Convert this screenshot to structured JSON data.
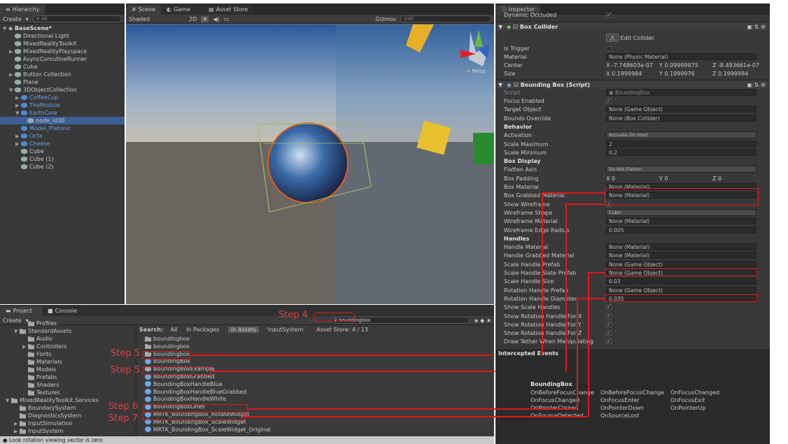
{
  "hierarchy": {
    "tab": "Hierarchy",
    "create": "Create",
    "search_placeholder": "All",
    "scene": "BaseScene*",
    "items": [
      {
        "label": "Directional Light",
        "depth": 1,
        "arrow": "",
        "blue": false
      },
      {
        "label": "MixedRealityToolkit",
        "depth": 1,
        "arrow": "",
        "blue": false
      },
      {
        "label": "MixedRealityPlayspace",
        "depth": 1,
        "arrow": "▶",
        "blue": false
      },
      {
        "label": "AsyncCoroutineRunner",
        "depth": 1,
        "arrow": "",
        "blue": false
      },
      {
        "label": "Cube",
        "depth": 1,
        "arrow": "",
        "blue": false
      },
      {
        "label": "Button Collection",
        "depth": 1,
        "arrow": "▶",
        "blue": false
      },
      {
        "label": "Plane",
        "depth": 1,
        "arrow": "",
        "blue": false
      },
      {
        "label": "3DObjectCollection",
        "depth": 1,
        "arrow": "▼",
        "blue": false
      },
      {
        "label": "CoffeeCup",
        "depth": 2,
        "arrow": "▶",
        "blue": true
      },
      {
        "label": "TheModule",
        "depth": 2,
        "arrow": "▶",
        "blue": true
      },
      {
        "label": "EarthCore",
        "depth": 2,
        "arrow": "▼",
        "blue": true
      },
      {
        "label": "node_id30",
        "depth": 3,
        "arrow": "",
        "blue": false,
        "selected": true
      },
      {
        "label": "Model_Platonic",
        "depth": 2,
        "arrow": "",
        "blue": true
      },
      {
        "label": "Octa",
        "depth": 2,
        "arrow": "▶",
        "blue": true
      },
      {
        "label": "Cheese",
        "depth": 2,
        "arrow": "▶",
        "blue": true
      },
      {
        "label": "Cube",
        "depth": 2,
        "arrow": "",
        "blue": false
      },
      {
        "label": "Cube (1)",
        "depth": 2,
        "arrow": "",
        "blue": false
      },
      {
        "label": "Cube (2)",
        "depth": 2,
        "arrow": "",
        "blue": false
      }
    ]
  },
  "scene": {
    "tabs": [
      "Scene",
      "Game",
      "Asset Store"
    ],
    "shaded": "Shaded",
    "mode_2d": "2D",
    "gizmos": "Gizmos",
    "search_placeholder": "All",
    "persp": "< Persp",
    "axis_y": "y",
    "axis_x": "x",
    "axis_z": "z"
  },
  "project": {
    "tabs": [
      "Project",
      "Console"
    ],
    "create": "Create",
    "search_value": "boundingbox",
    "search_label": "Search:",
    "filters": [
      "All",
      "In Packages",
      "In Assets",
      "'InputSystem'",
      "Asset Store: 4 / 13"
    ],
    "tree": [
      {
        "label": "Profiles",
        "depth": 2,
        "arrow": ""
      },
      {
        "label": "StandardAssets",
        "depth": 1,
        "arrow": "▼"
      },
      {
        "label": "Audio",
        "depth": 2,
        "arrow": ""
      },
      {
        "label": "Controllers",
        "depth": 2,
        "arrow": "▶"
      },
      {
        "label": "Fonts",
        "depth": 2,
        "arrow": ""
      },
      {
        "label": "Materials",
        "depth": 2,
        "arrow": ""
      },
      {
        "label": "Models",
        "depth": 2,
        "arrow": ""
      },
      {
        "label": "Prefabs",
        "depth": 2,
        "arrow": ""
      },
      {
        "label": "Shaders",
        "depth": 2,
        "arrow": ""
      },
      {
        "label": "Textures",
        "depth": 2,
        "arrow": ""
      },
      {
        "label": "MixedRealityToolkit.Services",
        "depth": 0,
        "arrow": "▼"
      },
      {
        "label": "BoundarySystem",
        "depth": 1,
        "arrow": ""
      },
      {
        "label": "DiagnosticsSystem",
        "depth": 1,
        "arrow": ""
      },
      {
        "label": "InputSimulation",
        "depth": 1,
        "arrow": "▶"
      },
      {
        "label": "InputSystem",
        "depth": 1,
        "arrow": "▶"
      }
    ],
    "results": [
      {
        "label": "boundingbox",
        "kind": "file"
      },
      {
        "label": "boundingbox",
        "kind": "file"
      },
      {
        "label": "boundingbox",
        "kind": "file"
      },
      {
        "label": "BoundingBox",
        "kind": "prefab"
      },
      {
        "label": "BoundingBoxExample",
        "kind": "scene"
      },
      {
        "label": "BoundingBoxGrabbed",
        "kind": "prefab"
      },
      {
        "label": "BoundingBoxHandleBlue",
        "kind": "prefab"
      },
      {
        "label": "BoundingBoxHandleBlueGrabbed",
        "kind": "prefab"
      },
      {
        "label": "BoundingBoxHandleWhite",
        "kind": "prefab"
      },
      {
        "label": "BoundingBoxLines",
        "kind": "prefab"
      },
      {
        "label": "MRTK_BoundingBox_RotateWidget",
        "kind": "prefab"
      },
      {
        "label": "MRTK_BoundingBox_ScaleWidget",
        "kind": "prefab"
      },
      {
        "label": "MRTK_BoundingBox_ScaleWidget_Original",
        "kind": "prefab"
      }
    ]
  },
  "status": {
    "text": "Look rotation viewing vector is zero"
  },
  "steps": {
    "s4": "Step 4",
    "s5a": "Step 5",
    "s5b": "Step 5",
    "s6": "Step 6",
    "s7": "Step 7"
  },
  "inspector": {
    "tab": "Inspector",
    "dynamic_occluded": "Dynamic Occluded",
    "box_collider": {
      "title": "Box Collider",
      "edit": "Edit Collider",
      "is_trigger": "Is Trigger",
      "material": "Material",
      "material_val": "None (Physic Material)",
      "center": "Center",
      "center_x": "X -7.748603e-07",
      "center_y": "Y 0.09999875",
      "center_z": "Z -8.493661e-07",
      "size": "Size",
      "size_x": "X 0.1999984",
      "size_y": "Y 0.1999976",
      "size_z": "Z 0.1999984"
    },
    "bbox": {
      "title": "Bounding Box (Script)",
      "script": "Script",
      "script_val": "BoundingBox",
      "rows": [
        {
          "label": "Focus Enabled",
          "type": "check",
          "value": "✓"
        },
        {
          "label": "Target Object",
          "type": "field",
          "value": "None (Game Object)"
        },
        {
          "label": "Bounds Override",
          "type": "field",
          "value": "None (Box Collider)"
        },
        {
          "label": "Behavior",
          "type": "header",
          "value": ""
        },
        {
          "label": "Activation",
          "type": "drop",
          "value": "Activate On Start"
        },
        {
          "label": "Scale Maximum",
          "type": "field",
          "value": "2"
        },
        {
          "label": "Scale Minimum",
          "type": "field",
          "value": "0.2"
        },
        {
          "label": "Box Display",
          "type": "header",
          "value": ""
        },
        {
          "label": "Flatten Axis",
          "type": "drop",
          "value": "Do Not Flatten"
        },
        {
          "label": "Box Padding",
          "type": "xyz",
          "value": "X 0|Y 0|Z 0"
        },
        {
          "label": "Box Material",
          "type": "field",
          "value": "None (Material)"
        },
        {
          "label": "Box Grabbed Material",
          "type": "field",
          "value": "None (Material)"
        },
        {
          "label": "Show Wireframe",
          "type": "check",
          "value": "✓"
        },
        {
          "label": "Wireframe Shape",
          "type": "drop",
          "value": "Cubic"
        },
        {
          "label": "Wireframe Material",
          "type": "field",
          "value": "None (Material)"
        },
        {
          "label": "Wireframe Edge Radius",
          "type": "field",
          "value": "0.005"
        },
        {
          "label": "Handles",
          "type": "header",
          "value": ""
        },
        {
          "label": "Handle Material",
          "type": "field",
          "value": "None (Material)"
        },
        {
          "label": "Handle Grabbed Material",
          "type": "field",
          "value": "None (Material)"
        },
        {
          "label": "Scale Handle Prefab",
          "type": "field",
          "value": "None (Game Object)"
        },
        {
          "label": "Scale Handle Slate Prefab",
          "type": "field",
          "value": "None (Game Object)"
        },
        {
          "label": "Scale Handle Size",
          "type": "field",
          "value": "0.03"
        },
        {
          "label": "Rotation Handle Prefab",
          "type": "field",
          "value": "None (Game Object)"
        },
        {
          "label": "Rotation Handle Diameter",
          "type": "field",
          "value": "0.035"
        },
        {
          "label": "Show Scale Handles",
          "type": "check",
          "value": "✓"
        },
        {
          "label": "Show Rotation Handle For X",
          "type": "check",
          "value": "✓"
        },
        {
          "label": "Show Rotation Handle For Y",
          "type": "check",
          "value": "✓"
        },
        {
          "label": "Show Rotation Handle For Z",
          "type": "check",
          "value": "✓"
        },
        {
          "label": "Draw Tether When Manipulating",
          "type": "check",
          "value": "✓"
        }
      ]
    },
    "intercepted": "Intercepted Events",
    "events_title": "BoundingBox",
    "events": [
      "OnBeforeFocusChange",
      "OnBeforeFocusChange",
      "OnFocusChanged",
      "OnFocusChanged",
      "OnFocusEnter",
      "OnFocusExit",
      "OnPointerClicked",
      "OnPointerDown",
      "OnPointerUp",
      "OnSourceDetected",
      "OnSourceLost"
    ]
  }
}
